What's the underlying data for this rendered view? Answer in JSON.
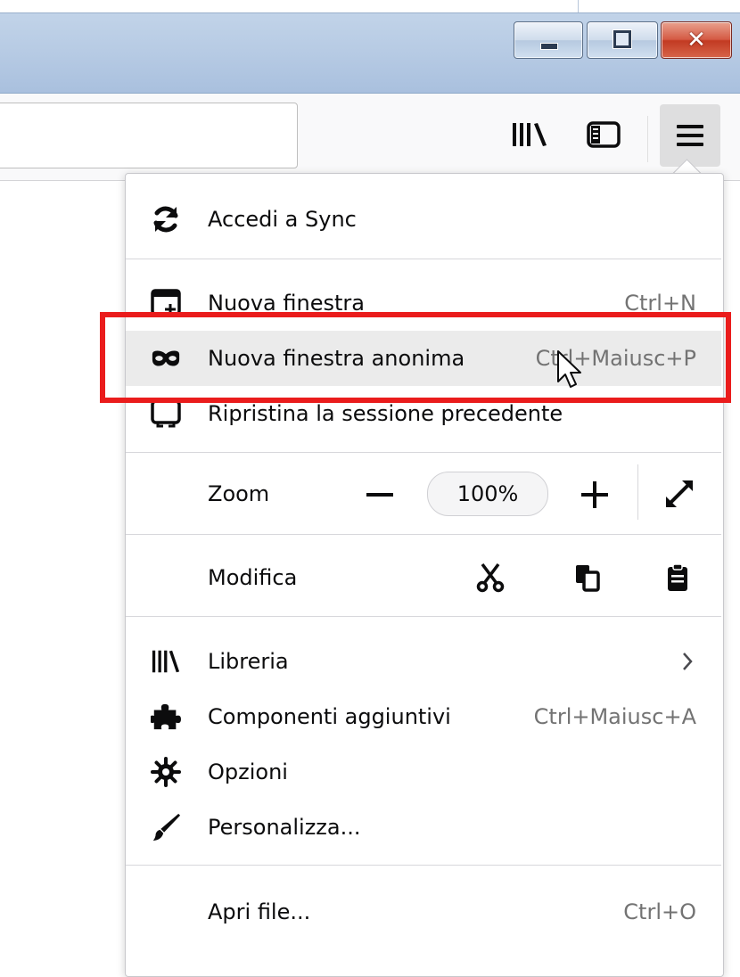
{
  "window": {
    "close_glyph": "✕"
  },
  "menu": {
    "sync": {
      "label": "Accedi a Sync",
      "icon": "sync-icon"
    },
    "new_window": {
      "label": "Nuova finestra",
      "shortcut": "Ctrl+N",
      "icon": "new-window-icon"
    },
    "private_window": {
      "label": "Nuova finestra anonima",
      "shortcut": "Ctrl+Maiusc+P",
      "icon": "private-mask-icon"
    },
    "restore_session": {
      "label": "Ripristina la sessione precedente",
      "icon": "restore-session-icon"
    },
    "zoom": {
      "label": "Zoom",
      "value": "100%"
    },
    "edit": {
      "label": "Modifica"
    },
    "library": {
      "label": "Libreria",
      "icon": "library-icon"
    },
    "addons": {
      "label": "Componenti aggiuntivi",
      "shortcut": "Ctrl+Maiusc+A",
      "icon": "puzzle-icon"
    },
    "options": {
      "label": "Opzioni",
      "icon": "gear-icon"
    },
    "customize": {
      "label": "Personalizza...",
      "icon": "brush-icon"
    },
    "open_file": {
      "label": "Apri file...",
      "shortcut": "Ctrl+O"
    }
  },
  "colors": {
    "highlight": "#ea1c1c",
    "hover": "#ebebeb",
    "shortcut_text": "#737373"
  }
}
